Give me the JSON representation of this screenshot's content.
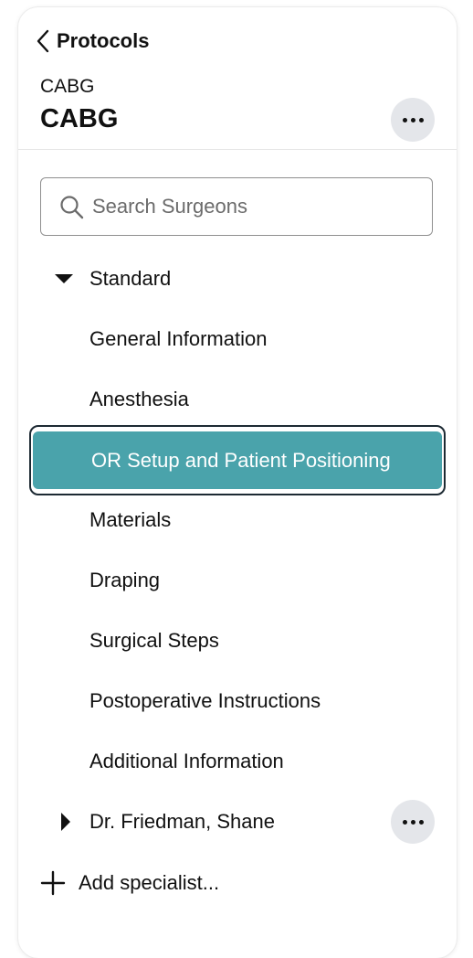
{
  "header": {
    "back_label": "Protocols",
    "subtitle": "CABG",
    "title": "CABG"
  },
  "search": {
    "placeholder": "Search Surgeons",
    "value": ""
  },
  "tree": {
    "group_label": "Standard",
    "group_expanded": true,
    "items": [
      {
        "label": "General Information",
        "selected": false
      },
      {
        "label": "Anesthesia",
        "selected": false
      },
      {
        "label": "OR Setup and Patient Positioning",
        "selected": true
      },
      {
        "label": "Materials",
        "selected": false
      },
      {
        "label": "Draping",
        "selected": false
      },
      {
        "label": "Surgical Steps",
        "selected": false
      },
      {
        "label": "Postoperative Instructions",
        "selected": false
      },
      {
        "label": "Additional Information",
        "selected": false
      }
    ],
    "surgeon_label": "Dr. Friedman, Shane",
    "surgeon_expanded": false
  },
  "add_specialist_label": "Add specialist...",
  "colors": {
    "selected_bg": "#4aa3ab",
    "selected_border": "#1d2a33",
    "more_button_bg": "#e4e6ea"
  },
  "icons": {
    "back": "chevron-left-icon",
    "more": "ellipsis-icon",
    "search": "search-icon",
    "expanded": "caret-down-icon",
    "collapsed": "caret-right-icon",
    "add": "plus-icon"
  }
}
